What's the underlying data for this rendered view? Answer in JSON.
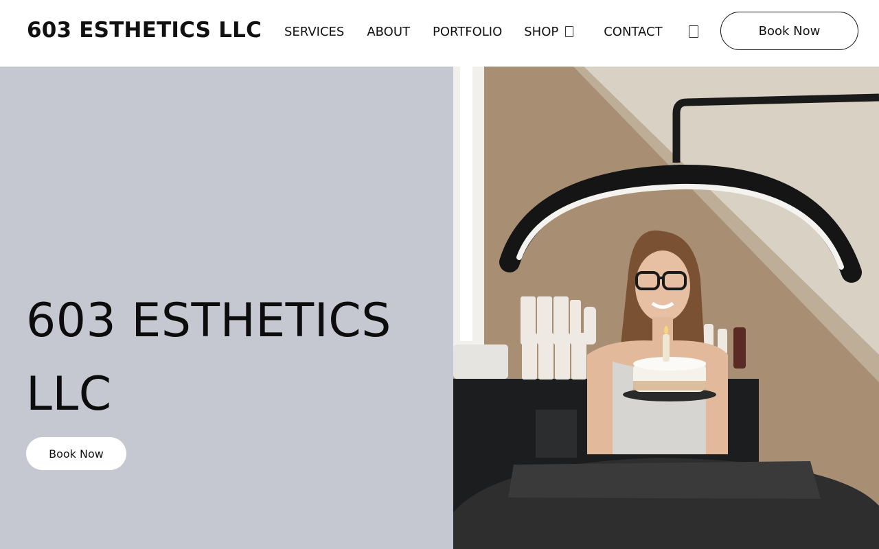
{
  "header": {
    "brand": "603 ESTHETICS LLC",
    "nav": [
      {
        "label": "SERVICES"
      },
      {
        "label": "ABOUT"
      },
      {
        "label": "PORTFOLIO"
      },
      {
        "label": "SHOP"
      },
      {
        "label": "CONTACT"
      }
    ],
    "shop_caret_icon": "dropdown-box-glyph",
    "cart_icon": "cart-box-glyph",
    "book_button": "Book Now"
  },
  "hero": {
    "title": "603 ESTHETICS LLC",
    "book_button": "Book Now",
    "background_color": "#c5c8d1",
    "image": "esthetician-with-birthday-cake-under-ring-light"
  }
}
